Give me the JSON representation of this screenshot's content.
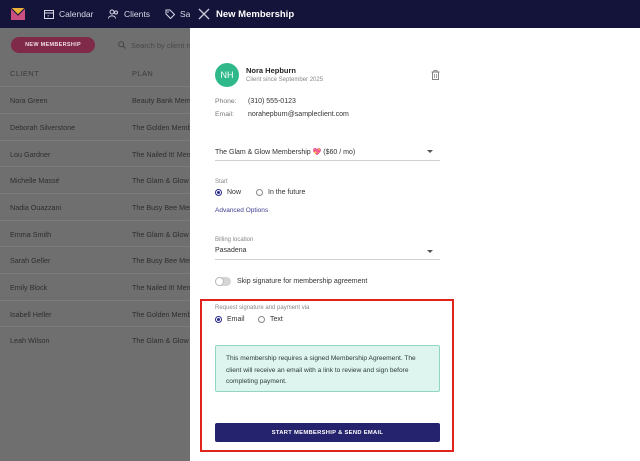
{
  "topnav": {
    "items": [
      {
        "label": "Calendar",
        "icon": "calendar-icon"
      },
      {
        "label": "Clients",
        "icon": "clients-icon"
      },
      {
        "label": "Sal",
        "icon": "tag-icon"
      }
    ]
  },
  "list": {
    "new_button": "NEW MEMBERSHIP",
    "search_placeholder": "Search by client n",
    "columns": [
      "CLIENT",
      "PLAN"
    ],
    "rows": [
      {
        "client": "Nora Green",
        "plan": "Beauty Bank Memb"
      },
      {
        "client": "Deborah Silverstone",
        "plan": "The Golden Memb"
      },
      {
        "client": "Lou Gardner",
        "plan": "The Nailed It! Mem"
      },
      {
        "client": "Michelle Massé",
        "plan": "The Glam & Glow"
      },
      {
        "client": "Nadia Ouazzani",
        "plan": "The Busy Bee Mem"
      },
      {
        "client": "Emma Smith",
        "plan": "The Glam & Glow"
      },
      {
        "client": "Sarah Geller",
        "plan": "The Busy Bee Mem"
      },
      {
        "client": "Emily Block",
        "plan": "The Nailed It! Mem"
      },
      {
        "client": "Isabell Heller",
        "plan": "The Golden Memb"
      },
      {
        "client": "Leah Wilson",
        "plan": "The Glam & Glow"
      }
    ]
  },
  "drawer": {
    "title": "New Membership",
    "client": {
      "initials": "NH",
      "name": "Nora Hepburn",
      "since": "Client since September 2025",
      "phone_label": "Phone:",
      "phone": "(310) 555-0123",
      "email_label": "Email:",
      "email": "norahepburn@sampleclient.com"
    },
    "plan_select": "The Glam & Glow Membership 💖 ($60 / mo)",
    "start": {
      "label": "Start",
      "options": [
        "Now",
        "In the future"
      ],
      "selected": "Now",
      "advanced_link": "Advanced Options"
    },
    "billing": {
      "label": "Billing location",
      "value": "Pasadena"
    },
    "skip_signature": {
      "label": "Skip signature for membership agreement",
      "enabled": false
    },
    "request_via": {
      "label": "Request signature and payment via",
      "options": [
        "Email",
        "Text"
      ],
      "selected": "Email"
    },
    "info_text": "This membership requires a signed Membership Agreement. The client will receive an email with a link to review and sign before completing payment.",
    "cta": "START MEMBERSHIP & SEND EMAIL"
  },
  "colors": {
    "navbar": "#14133a",
    "accent": "#26236e",
    "avatar": "#2fb98a",
    "info_bg": "#def4ef",
    "highlight": "#e0241b"
  }
}
